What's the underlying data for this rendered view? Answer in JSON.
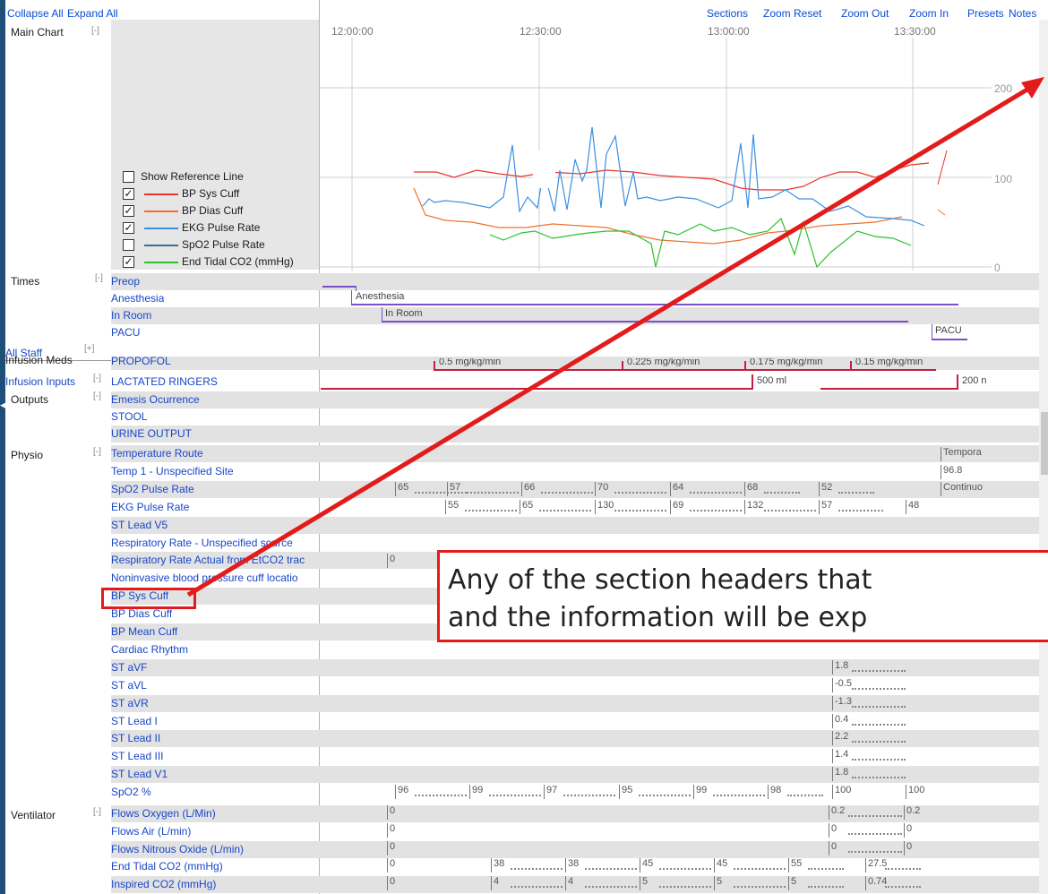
{
  "toolbar": {
    "collapse_all": "Collapse All",
    "expand_all": "Expand All",
    "sections": "Sections",
    "zoom_reset": "Zoom Reset",
    "zoom_out": "Zoom Out",
    "zoom_in": "Zoom In",
    "presets": "Presets",
    "notes": "Notes"
  },
  "main_chart": {
    "label": "Main Chart",
    "toggle": "[-]",
    "time_labels": [
      "12:00:00",
      "12:30:00",
      "13:00:00",
      "13:30:00"
    ],
    "y_ticks": [
      "200",
      "100",
      "0"
    ],
    "legend": [
      {
        "label": "Show Reference Line",
        "checked": false,
        "color": ""
      },
      {
        "label": "BP Sys Cuff",
        "checked": true,
        "color": "#e8342c"
      },
      {
        "label": "BP Dias Cuff",
        "checked": true,
        "color": "#f07030"
      },
      {
        "label": "EKG Pulse Rate",
        "checked": true,
        "color": "#3c8fe0"
      },
      {
        "label": "SpO2 Pulse Rate",
        "checked": false,
        "color": "#3a6e8c"
      },
      {
        "label": "End Tidal CO2 (mmHg)",
        "checked": true,
        "color": "#2ec02e"
      }
    ]
  },
  "times": {
    "label": "Times",
    "toggle": "[-]",
    "rows": [
      "Preop",
      "Anesthesia",
      "In Room",
      "PACU"
    ],
    "bar_labels": {
      "anesthesia": "Anesthesia",
      "in_room": "In Room",
      "pacu": "PACU"
    }
  },
  "all_staff": {
    "label": "All Staff",
    "toggle": "[+]"
  },
  "infusion_meds": {
    "label": "Infusion Meds",
    "toggle": "[-]",
    "row": "PROPOFOL",
    "doses": [
      "0.5 mg/kg/min",
      "0.225 mg/kg/min",
      "0.175 mg/kg/min",
      "0.15 mg/kg/min"
    ]
  },
  "infusion_inputs": {
    "label": "Infusion Inputs",
    "toggle": "[-]",
    "row": "LACTATED RINGERS",
    "volumes": [
      "500 ml",
      "200 n"
    ]
  },
  "outputs": {
    "label": "Outputs",
    "toggle": "[-]",
    "rows": [
      "Emesis Ocurrence",
      "STOOL",
      "URINE OUTPUT"
    ]
  },
  "physio": {
    "label": "Physio",
    "toggle": "[-]",
    "rows": [
      "Temperature Route",
      "Temp 1 - Unspecified Site",
      "SpO2 Pulse Rate",
      "EKG Pulse Rate",
      "ST Lead V5",
      "Respiratory Rate - Unspecified source",
      "Respiratory Rate Actual from EtCO2 trac",
      "Noninvasive blood pressure cuff locatio",
      "BP Sys Cuff",
      "BP Dias Cuff",
      "BP Mean Cuff",
      "Cardiac Rhythm",
      "ST aVF",
      "ST aVL",
      "ST aVR",
      "ST Lead I",
      "ST Lead II",
      "ST Lead III",
      "ST Lead V1",
      "SpO2 %"
    ],
    "temperature_route": "Tempora",
    "temp_value": "96.8",
    "spo2_pulse_values": [
      "65",
      "57",
      "66",
      "70",
      "64",
      "68",
      "52",
      "Continuo"
    ],
    "ekg_pulse_values": [
      "55",
      "65",
      "130",
      "69",
      "132",
      "57",
      "48"
    ],
    "resp_rate_value": "0",
    "st_values": {
      "avf": "1.8",
      "avl": "-0.5",
      "avr": "-1.3",
      "lead1": "0.4",
      "lead2": "2.2",
      "lead3": "1.4",
      "v1": "1.8"
    },
    "spo2_pct_values": [
      "96",
      "99",
      "97",
      "95",
      "99",
      "98",
      "100",
      "100"
    ]
  },
  "ventilator": {
    "label": "Ventilator",
    "toggle": "[-]",
    "rows": [
      "Flows Oxygen (L/Min)",
      "Flows Air (L/min)",
      "Flows Nitrous Oxide (L/min)",
      "End Tidal CO2 (mmHg)",
      "Inspired CO2 (mmHg)"
    ],
    "oxygen_values": [
      "0",
      "0.2",
      "0.2"
    ],
    "air_values": [
      "0",
      "0",
      "0"
    ],
    "nitrous_values": [
      "0",
      "0",
      "0"
    ],
    "etco2_values": [
      "0",
      "38",
      "38",
      "45",
      "45",
      "55",
      "27.5"
    ],
    "inspired_values": [
      "0",
      "4",
      "4",
      "5",
      "5",
      "5",
      "0.74"
    ]
  },
  "callout": {
    "line1": "Any of the section headers that",
    "line2": "and the information will be exp"
  }
}
